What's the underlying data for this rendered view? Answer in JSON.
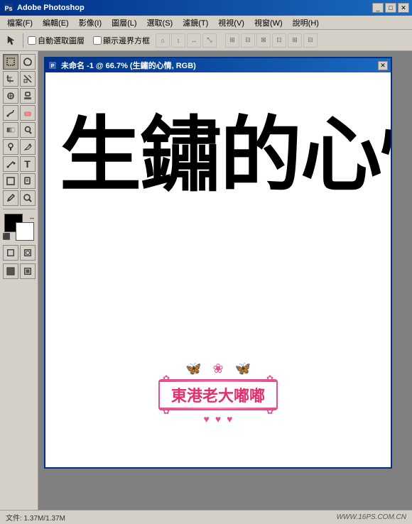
{
  "titleBar": {
    "appTitle": "Adobe Photoshop",
    "minimizeLabel": "_",
    "maximizeLabel": "□",
    "closeLabel": "✕"
  },
  "menuBar": {
    "items": [
      {
        "label": "檔案(F)"
      },
      {
        "label": "編輯(E)"
      },
      {
        "label": "影像(I)"
      },
      {
        "label": "圖層(L)"
      },
      {
        "label": "選取(S)"
      },
      {
        "label": "濾鏡(T)"
      },
      {
        "label": "視視(V)"
      },
      {
        "label": "視窗(W)"
      },
      {
        "label": "說明(H)"
      }
    ]
  },
  "toolbar": {
    "checkboxLabel1": "自動選取圖層",
    "checkboxLabel2": "顯示邊界方框"
  },
  "docWindow": {
    "title": "未命名 -1 @ 66.7% (生鏽的心情, RGB)",
    "closeLabel": "✕"
  },
  "canvas": {
    "mainText": "生鏽的心情",
    "subText": "東港老大嘟嘟"
  },
  "statusBar": {
    "watermark": "WWW.16PS.COM.CN"
  }
}
